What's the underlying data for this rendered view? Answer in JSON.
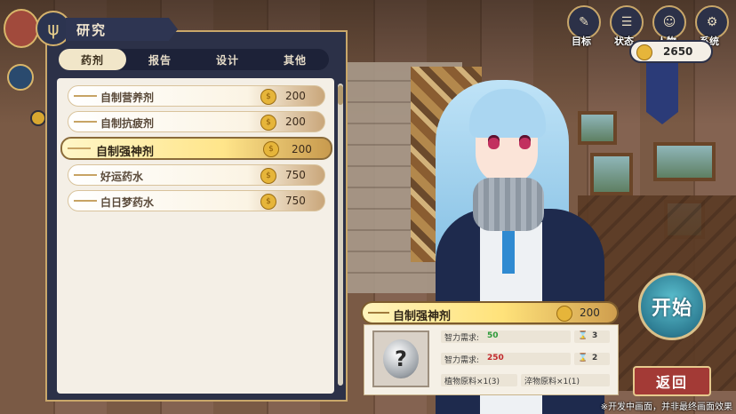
{
  "header": {
    "title": "研究"
  },
  "tabs": [
    {
      "label": "药剂",
      "active": true
    },
    {
      "label": "报告",
      "active": false
    },
    {
      "label": "设计",
      "active": false
    },
    {
      "label": "其他",
      "active": false
    }
  ],
  "recipes": [
    {
      "name": "自制营养剂",
      "price": "200"
    },
    {
      "name": "自制抗疲剂",
      "price": "200"
    },
    {
      "name": "自制强神剂",
      "price": "200",
      "selected": true
    },
    {
      "name": "好运药水",
      "price": "750"
    },
    {
      "name": "白日梦药水",
      "price": "750"
    }
  ],
  "top_menu": [
    {
      "label": "目标",
      "icon": "target-icon"
    },
    {
      "label": "状态",
      "icon": "status-icon"
    },
    {
      "label": "人物",
      "icon": "people-icon"
    },
    {
      "label": "系统",
      "icon": "gear-icon"
    }
  ],
  "money": {
    "value": "2650"
  },
  "detail": {
    "name": "自制强神剂",
    "price": "200",
    "requirements": [
      {
        "label": "智力需求:",
        "value": "50",
        "count": "3",
        "color": "#2e9a3a"
      },
      {
        "label": "智力需求:",
        "value": "250",
        "count": "2",
        "color": "#c2282b"
      }
    ],
    "materials": [
      "植物原料×1(3)",
      "淬物原料×1(1)"
    ]
  },
  "buttons": {
    "start": "开始",
    "back": "返回"
  },
  "footer_note": "※开发中画面，并非最终画面效果",
  "colors": {
    "panel": "#2c3148",
    "gold": "#c9a76a",
    "selected_row": "#ffe58a",
    "start": "#2e7d93",
    "back": "#a33a36"
  }
}
